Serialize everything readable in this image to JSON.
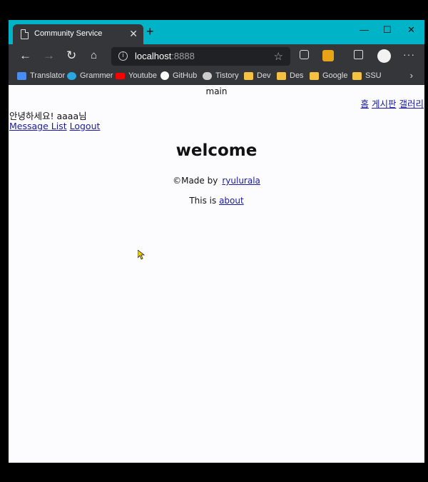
{
  "browser": {
    "tab_title": "Community Service",
    "tab_close": "✕",
    "new_tab": "+",
    "controls": {
      "minimize": "—",
      "maximize": "☐",
      "close": "✕"
    },
    "url_host": "localhost",
    "url_port": ":8888",
    "icons": [
      "back-icon",
      "forward-icon",
      "reload-icon",
      "home-icon",
      "site-info-icon",
      "favorite-star-icon",
      "qr-code-icon",
      "shield-extension-icon",
      "collections-icon",
      "profile-avatar",
      "more-menu-icon"
    ]
  },
  "bookmarks": [
    {
      "label": "Translator",
      "icon": "translator-icon",
      "color": "#4a8df0"
    },
    {
      "label": "Grammer",
      "icon": "grammarly-icon",
      "color": "#2aa7e0"
    },
    {
      "label": "Youtube",
      "icon": "youtube-icon",
      "color": "#ff0000"
    },
    {
      "label": "GitHub",
      "icon": "github-icon",
      "color": "#ffffff"
    },
    {
      "label": "Tistory",
      "icon": "tistory-icon",
      "color": "#cccccc"
    },
    {
      "label": "Dev",
      "icon": "folder-icon",
      "color": "#f4c142"
    },
    {
      "label": "Des",
      "icon": "folder-icon",
      "color": "#f4c142"
    },
    {
      "label": "Google",
      "icon": "folder-icon",
      "color": "#f4c142"
    },
    {
      "label": "SSU",
      "icon": "folder-icon",
      "color": "#f4c142"
    }
  ],
  "page": {
    "header_title": "main",
    "nav": [
      "홈",
      "게시판",
      "갤러리"
    ],
    "greeting": "안녕하세요! aaaa님",
    "user_links": [
      "Message List",
      "Logout"
    ],
    "welcome": "welcome",
    "credit_prefix": "©Made by",
    "credit_author": "ryulurala",
    "about_prefix": "This is",
    "about_link": "about"
  },
  "colors": {
    "titlebar": "#00b3c7",
    "toolbar": "#35363a",
    "link": "#1a1aa6"
  }
}
